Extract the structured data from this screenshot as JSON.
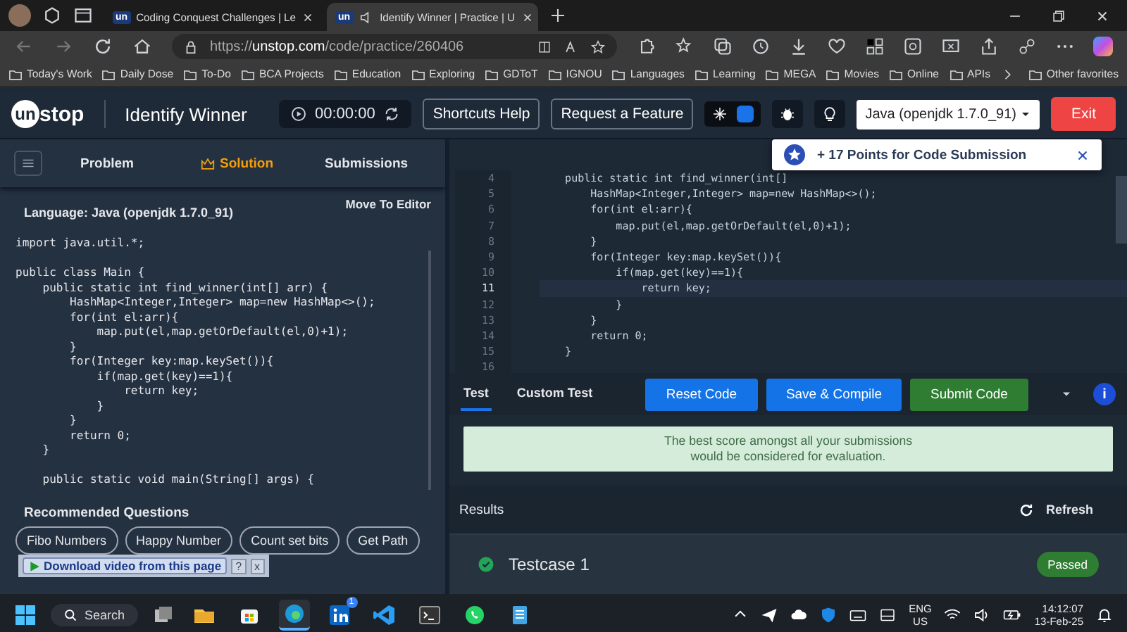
{
  "browser": {
    "tabs": [
      {
        "favicon": "un",
        "title": "Coding Conquest Challenges | Le",
        "audio": false,
        "selected": false
      },
      {
        "favicon": "un",
        "title": "Identify Winner | Practice | U",
        "audio": true,
        "selected": true
      }
    ],
    "address": {
      "scheme": "https://",
      "domain": "unstop.com",
      "path": "/code/practice/260406"
    },
    "bookmarks": [
      "Today's Work",
      "Daily Dose",
      "To-Do",
      "BCA Projects",
      "Education",
      "Exploring",
      "GDToT",
      "IGNOU",
      "Languages",
      "Learning",
      "MEGA",
      "Movies",
      "Online",
      "APIs"
    ],
    "other_favorites": "Other favorites"
  },
  "header": {
    "logo": {
      "circled": "un",
      "rest": "stop"
    },
    "title": "Identify Winner",
    "timer": "00:00:00",
    "buttons": [
      "Shortcuts Help",
      "Request a Feature"
    ],
    "toggle_on": true,
    "language": "Java (openjdk 1.7.0_91)",
    "exit": "Exit"
  },
  "left": {
    "tabs": [
      {
        "label": "Problem",
        "selected": false
      },
      {
        "label": "Solution",
        "selected": true
      },
      {
        "label": "Submissions",
        "selected": false
      }
    ],
    "language_label": "Language: Java (openjdk 1.7.0_91)",
    "move_to_editor": "Move To Editor",
    "code_blocks": [
      [
        "import java.util.*;"
      ],
      [
        "public class Main {",
        "    public static int find_winner(int[] arr) {",
        "        HashMap<Integer,Integer> map=new HashMap<>();",
        "        for(int el:arr){",
        "            map.put(el,map.getOrDefault(el,0)+1);",
        "        }",
        "        for(Integer key:map.keySet()){",
        "            if(map.get(key)==1){",
        "                return key;",
        "            }",
        "        }",
        "        return 0;",
        "    }"
      ],
      [
        "    public static void main(String[] args) {"
      ]
    ],
    "recommended_title": "Recommended Questions",
    "recommended": [
      "Fibo Numbers",
      "Happy Number",
      "Count set bits",
      "Get Path"
    ]
  },
  "download_bar": {
    "label": "Download video from this page",
    "help": "?",
    "close": "x"
  },
  "editor": {
    "lines": [
      {
        "number": "4",
        "code": "    public static int find_winner(int[]",
        "selected": false
      },
      {
        "number": "5",
        "code": "        HashMap<Integer,Integer> map=new HashMap<>();",
        "selected": false
      },
      {
        "number": "6",
        "code": "        for(int el:arr){",
        "selected": false
      },
      {
        "number": "7",
        "code": "            map.put(el,map.getOrDefault(el,0)+1);",
        "selected": false
      },
      {
        "number": "8",
        "code": "        }",
        "selected": false
      },
      {
        "number": "9",
        "code": "        for(Integer key:map.keySet()){",
        "selected": false
      },
      {
        "number": "10",
        "code": "            if(map.get(key)==1){",
        "selected": false
      },
      {
        "number": "11",
        "code": "                return key;",
        "selected": true
      },
      {
        "number": "12",
        "code": "            }",
        "selected": false
      },
      {
        "number": "13",
        "code": "        }",
        "selected": false
      },
      {
        "number": "14",
        "code": "        return 0;",
        "selected": false
      },
      {
        "number": "15",
        "code": "    }",
        "selected": false
      },
      {
        "number": "16",
        "selected": false
      }
    ],
    "toast": "+ 17 Points for Code Submission"
  },
  "console": {
    "tabs": [
      {
        "label": "Test",
        "selected": true
      },
      {
        "label": "Custom Test",
        "selected": false
      }
    ],
    "buttons": [
      {
        "label": "Reset Code",
        "kind": "primary"
      },
      {
        "label": "Save & Compile",
        "kind": "primary"
      },
      {
        "label": "Submit Code",
        "kind": "success"
      }
    ],
    "info": "i",
    "notice": [
      "The best score amongst all your submissions",
      "would be considered for evaluation."
    ],
    "results_title": "Results",
    "refresh": "Refresh",
    "testcases": [
      {
        "name": "Testcase 1",
        "status": "Passed",
        "passed": true
      }
    ]
  },
  "taskbar": {
    "search": "Search",
    "apps": [
      {
        "kind": "explorer",
        "active": false
      },
      {
        "kind": "store",
        "active": false
      },
      {
        "kind": "edge",
        "active": true
      },
      {
        "kind": "linkedin",
        "active": false,
        "badge": "1"
      },
      {
        "kind": "vscode",
        "active": false
      },
      {
        "kind": "terminal",
        "active": false
      },
      {
        "kind": "whatsapp",
        "active": false
      },
      {
        "kind": "notepad",
        "active": false
      }
    ],
    "language": [
      "ENG",
      "US"
    ],
    "time": "14:12:07",
    "date": "13-Feb-25"
  }
}
